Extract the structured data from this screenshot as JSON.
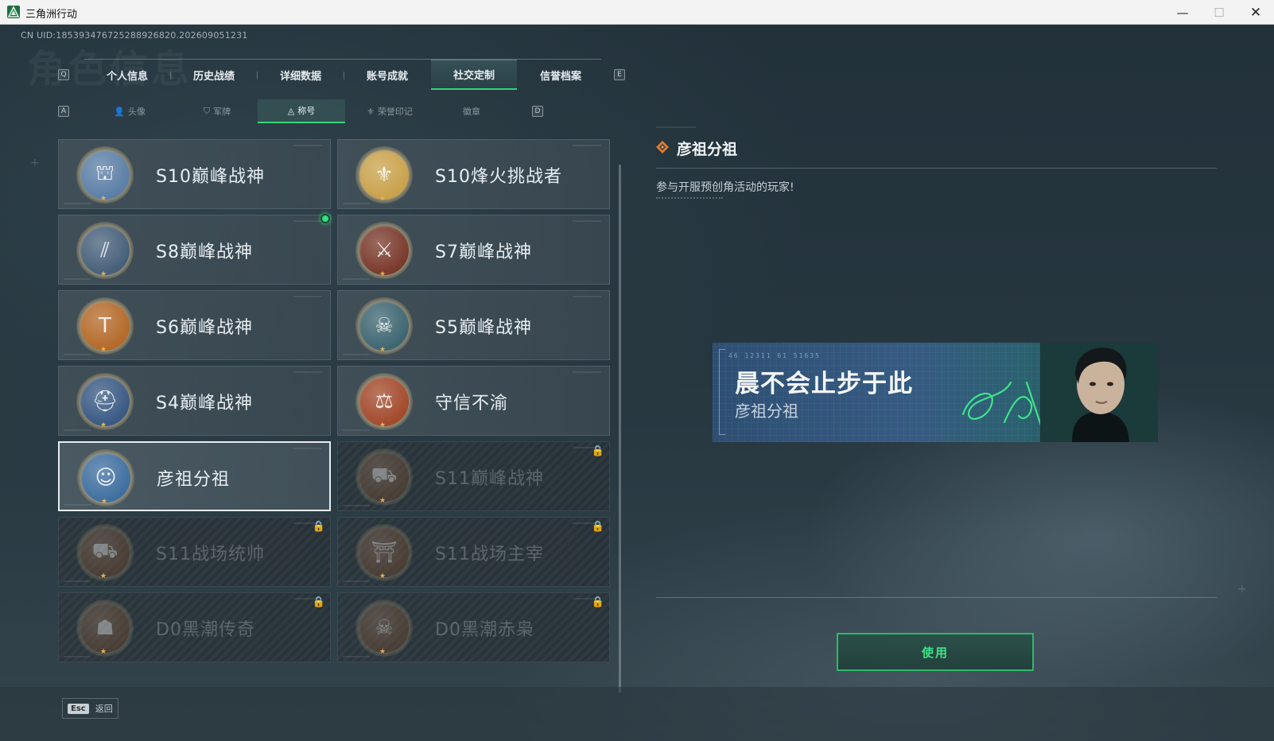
{
  "window": {
    "title": "三角洲行动",
    "minimize_glyph": "—",
    "maximize_glyph": "☐",
    "close_glyph": "✕"
  },
  "uid_text": "CN UID:18539347672528892682​0.202609051231",
  "ghost_title": "角色信息",
  "top_tabs": {
    "left_key": "Q",
    "right_key": "E",
    "items": [
      {
        "label": "个人信息",
        "active": false
      },
      {
        "label": "历史战绩",
        "active": false
      },
      {
        "label": "详细数据",
        "active": false
      },
      {
        "label": "账号成就",
        "active": false
      },
      {
        "label": "社交定制",
        "active": true
      },
      {
        "label": "信誉档案",
        "active": false
      }
    ]
  },
  "sub_tabs": {
    "left_key": "A",
    "right_key": "D",
    "items": [
      {
        "label": "头像",
        "icon": "person-icon",
        "glyph": "👤",
        "active": false
      },
      {
        "label": "军牌",
        "icon": "dogtag-icon",
        "glyph": "⛉",
        "active": false
      },
      {
        "label": "称号",
        "icon": "triangle-icon",
        "glyph": "◬",
        "active": true
      },
      {
        "label": "荣誉印记",
        "icon": "emblem-icon",
        "glyph": "⚜",
        "active": false
      },
      {
        "label": "徽章",
        "icon": "",
        "glyph": "",
        "active": false
      }
    ]
  },
  "titles": [
    {
      "name": "S10巅峰战神",
      "icon": "tower-badge-icon",
      "glyph": "⛫",
      "locked": false,
      "selected": false,
      "color": "#5c7fa6",
      "new_dot": false
    },
    {
      "name": "S10烽火挑战者",
      "icon": "gold-crest-badge-icon",
      "glyph": "⚜",
      "locked": false,
      "selected": false,
      "color": "#c9a24c",
      "new_dot": false
    },
    {
      "name": "S8巅峰战神",
      "icon": "stripes-badge-icon",
      "glyph": "⫽",
      "locked": false,
      "selected": false,
      "color": "#46607a",
      "new_dot": true
    },
    {
      "name": "S7巅峰战神",
      "icon": "rifle-badge-icon",
      "glyph": "⚔",
      "locked": false,
      "selected": false,
      "color": "#7a3a2c",
      "new_dot": false
    },
    {
      "name": "S6巅峰战神",
      "icon": "t-shield-badge-icon",
      "glyph": "T",
      "locked": false,
      "selected": false,
      "color": "#b46a2a",
      "new_dot": false
    },
    {
      "name": "S5巅峰战神",
      "icon": "gas-mask-badge-icon",
      "glyph": "☠",
      "locked": false,
      "selected": false,
      "color": "#3e6672",
      "new_dot": false
    },
    {
      "name": "S4巅峰战神",
      "icon": "helmet-badge-icon",
      "glyph": "⛑",
      "locked": false,
      "selected": false,
      "color": "#3a5a84",
      "new_dot": false
    },
    {
      "name": "守信不渝",
      "icon": "scales-badge-icon",
      "glyph": "⚖",
      "locked": false,
      "selected": false,
      "color": "#a34a2c",
      "new_dot": false
    },
    {
      "name": "彦祖分祖",
      "icon": "portrait-badge-icon",
      "glyph": "☺",
      "locked": false,
      "selected": true,
      "color": "#3f6fa0",
      "new_dot": false
    },
    {
      "name": "S11巅峰战神",
      "icon": "tank-badge-icon",
      "glyph": "⛟",
      "locked": true,
      "selected": false,
      "color": "#6e4a30",
      "new_dot": false
    },
    {
      "name": "S11战场统帅",
      "icon": "apc-badge-icon",
      "glyph": "⛟",
      "locked": true,
      "selected": false,
      "color": "#6e4a30",
      "new_dot": false
    },
    {
      "name": "S11战场主宰",
      "icon": "arch-badge-icon",
      "glyph": "⛩",
      "locked": true,
      "selected": false,
      "color": "#6e4a30",
      "new_dot": false
    },
    {
      "name": "D0黑潮传奇",
      "icon": "hooded-figure-badge-icon",
      "glyph": "☗",
      "locked": true,
      "selected": false,
      "color": "#6e4a30",
      "new_dot": false
    },
    {
      "name": "D0黑潮赤枭",
      "icon": "skull-badge-icon",
      "glyph": "☠",
      "locked": true,
      "selected": false,
      "color": "#6e4a30",
      "new_dot": false
    }
  ],
  "detail": {
    "title": "彦祖分祖",
    "description": "参与开服预创角活动的玩家!",
    "banner": {
      "code": "46 12311   61 51635",
      "main_text": "晨不会止步于此",
      "sub_text": "彦祖分祖"
    },
    "use_button": "使用"
  },
  "footer": {
    "esc_key": "Esc",
    "back_label": "返回"
  },
  "colors": {
    "accent_green": "#2fd67a",
    "lock_gray": "#bfc6ca"
  }
}
